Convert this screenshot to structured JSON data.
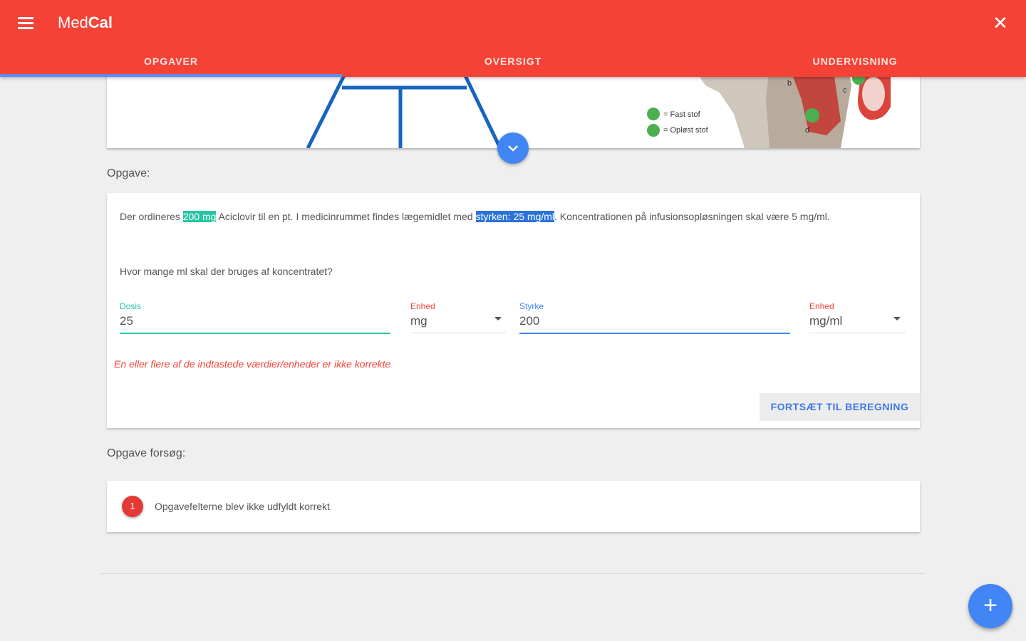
{
  "app": {
    "title_light": "Med",
    "title_bold": "Cal",
    "menu_icon": "hamburger-menu-icon",
    "close_icon": "close-icon"
  },
  "tabs": [
    {
      "label": "OPGAVER",
      "active": true
    },
    {
      "label": "OVERSIGT",
      "active": false
    },
    {
      "label": "UNDERVISNING",
      "active": false
    }
  ],
  "illustration": {
    "legend": [
      {
        "label": "= Fast stof",
        "color": "#4caf50"
      },
      {
        "label": "= Opløst stof",
        "color": "#4caf50"
      }
    ],
    "labels": [
      "b",
      "c",
      "d"
    ]
  },
  "task": {
    "section_label": "Opgave:",
    "text_before": "Der ordineres ",
    "highlight_dose": "200 mg",
    "text_middle": " Aciclovir til en pt. I medicinrummet findes lægemidlet med ",
    "highlight_strength": "styrken: 25 mg/ml",
    "text_after": ". Koncentrationen på infusionsopløsningen skal være 5 mg/ml.",
    "question": "Hvor mange ml skal der bruges af koncentratet?"
  },
  "fields": {
    "dose": {
      "label": "Dosis",
      "value": "25"
    },
    "dose_unit": {
      "label": "Enhed",
      "value": "mg"
    },
    "strength": {
      "label": "Styrke",
      "value": "200"
    },
    "strength_unit": {
      "label": "Enhed",
      "value": "mg/ml"
    }
  },
  "error_message": "En eller flere af de indtastede værdier/enheder er ikke korrekte",
  "continue_button": "FORTSÆT TIL BEREGNING",
  "attempts": {
    "section_label": "Opgave forsøg:",
    "items": [
      {
        "number": "1",
        "text": "Opgavefelterne blev ikke udfyldt korrekt"
      }
    ]
  },
  "colors": {
    "primary": "#f44336",
    "accent": "#4285f4",
    "teal": "#26c6a5",
    "error": "#f44336"
  }
}
